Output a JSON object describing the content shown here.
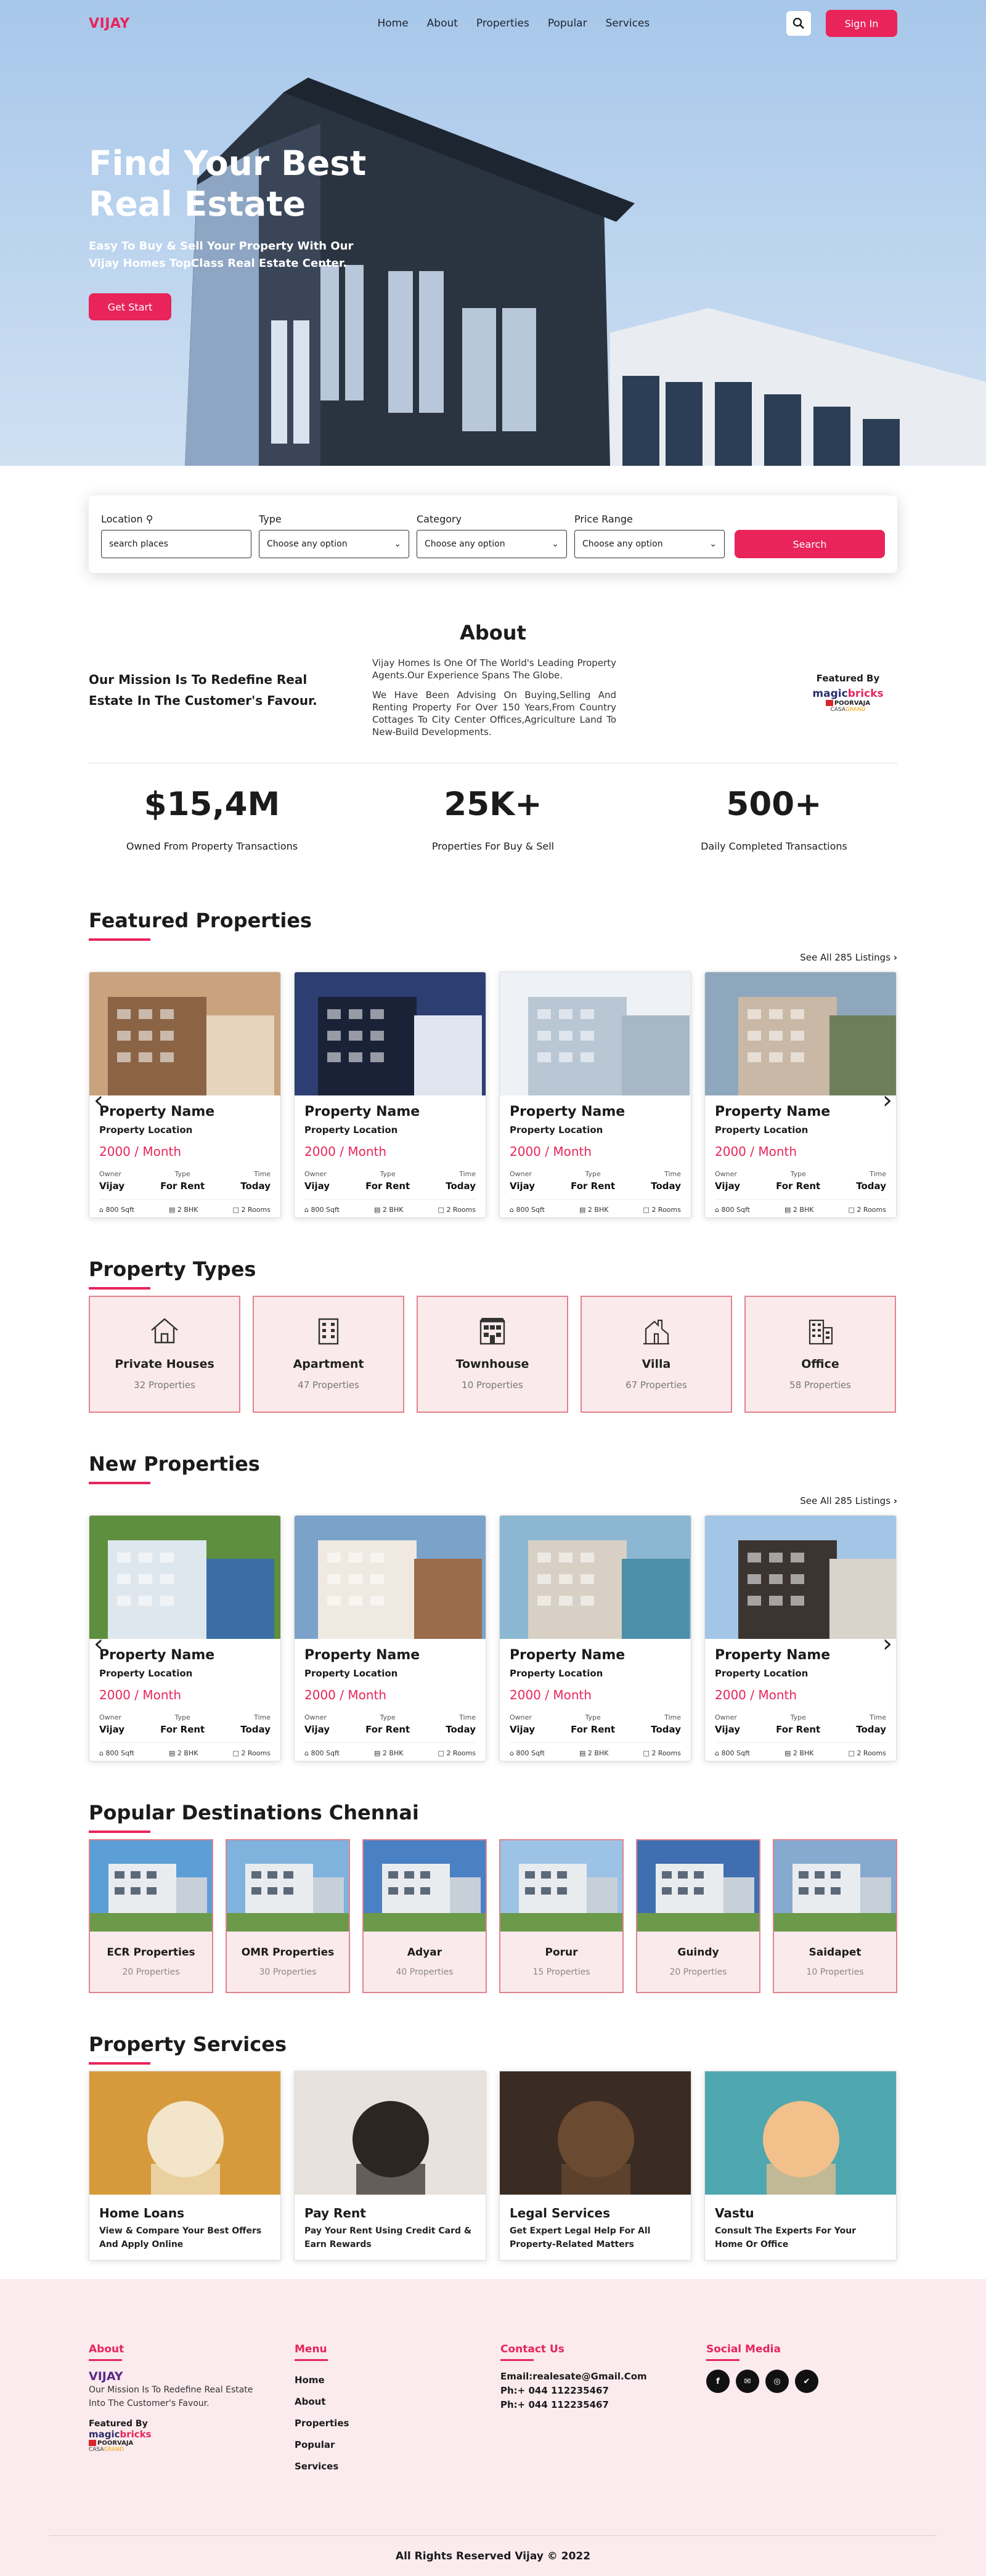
{
  "nav": {
    "logo": "VIJAY",
    "links": [
      "Home",
      "About",
      "Properties",
      "Popular",
      "Services"
    ],
    "signin": "Sign In"
  },
  "hero": {
    "title": "Find Your Best Real Estate",
    "subtitle": "Easy To Buy & Sell Your Property With Our Vijay Homes TopClass Real Estate Center.",
    "cta": "Get Start"
  },
  "search": {
    "location_label": "Location",
    "location_placeholder": "search places",
    "type_label": "Type",
    "category_label": "Category",
    "price_label": "Price Range",
    "select_value": "Choose any option",
    "button": "Search"
  },
  "about": {
    "title": "About",
    "mission": "Our Mission Is To Redefine Real Estate In The Customer's Favour.",
    "desc1": "Vijay Homes Is One Of The World's Leading Property Agents.Our Experience Spans The Globe.",
    "desc2": "We Have Been Advising On Buying,Selling And Renting Property For Over 150 Years,From Country Cottages To City Center Offices,Agriculture Land To New-Build Developments.",
    "featured_by": "Featured By",
    "logos": {
      "magic1": "magic",
      "magic2": "bricks",
      "pm": "POORVAJA",
      "cg1": "CASA",
      "cg2": "GRAND"
    }
  },
  "stats": [
    {
      "value": "$15,4M",
      "label": "Owned From Property Transactions"
    },
    {
      "value": "25K+",
      "label": "Properties For Buy & Sell"
    },
    {
      "value": "500+",
      "label": "Daily Completed Transactions"
    }
  ],
  "featured": {
    "title": "Featured Properties",
    "see_all": "See All 285 Listings"
  },
  "new_props": {
    "title": "New Properties",
    "see_all": "See All 285 Listings"
  },
  "card": {
    "name": "Property Name",
    "location": "Property Location",
    "price": "2000 / Month",
    "owner_label": "Owner",
    "owner": "Vijay",
    "type_label": "Type",
    "type": "For Rent",
    "time_label": "Time",
    "time": "Today",
    "sqft": "800 Sqft",
    "bhk": "2 BHK",
    "rooms": "2 Rooms"
  },
  "types": {
    "title": "Property Types",
    "items": [
      {
        "name": "Private Houses",
        "count": "32 Properties",
        "icon": "house-icon"
      },
      {
        "name": "Apartment",
        "count": "47 Properties",
        "icon": "apartment-icon"
      },
      {
        "name": "Townhouse",
        "count": "10 Properties",
        "icon": "townhouse-icon"
      },
      {
        "name": "Villa",
        "count": "67 Properties",
        "icon": "villa-icon"
      },
      {
        "name": "Office",
        "count": "58 Properties",
        "icon": "office-icon"
      }
    ]
  },
  "destinations": {
    "title": "Popular Destinations Chennai",
    "items": [
      {
        "name": "ECR Properties",
        "count": "20 Properties"
      },
      {
        "name": "OMR Properties",
        "count": "30 Properties"
      },
      {
        "name": "Adyar",
        "count": "40 Properties"
      },
      {
        "name": "Porur",
        "count": "15 Properties"
      },
      {
        "name": "Guindy",
        "count": "20 Properties"
      },
      {
        "name": "Saidapet",
        "count": "10 Properties"
      }
    ]
  },
  "services": {
    "title": "Property Services",
    "items": [
      {
        "name": "Home Loans",
        "desc": "View & Compare Your Best Offers And Apply Online"
      },
      {
        "name": "Pay Rent",
        "desc": "Pay Your Rent Using Credit Card & Earn Rewards"
      },
      {
        "name": "Legal Services",
        "desc": "Get Expert Legal Help For All Property-Related Matters"
      },
      {
        "name": "Vastu",
        "desc": "Consult The Experts For Your Home Or Office"
      }
    ]
  },
  "footer": {
    "about_h": "About",
    "brand": "VIJAY",
    "mission": "Our Mission Is To Redefine Real Estate Into The Customer's Favour.",
    "featured_by": "Featured By",
    "menu_h": "Menu",
    "menu": [
      "Home",
      "About",
      "Properties",
      "Popular",
      "Services"
    ],
    "contact_h": "Contact Us",
    "email": "Email:realesate@Gmail.Com",
    "ph1": "Ph:+ 044 112235467",
    "ph2": "Ph:+ 044 112235467",
    "social_h": "Social Media",
    "social": [
      "f",
      "✉",
      "◎",
      "✔"
    ],
    "copyright": "All Rights Reserved Vijay © 2022"
  }
}
